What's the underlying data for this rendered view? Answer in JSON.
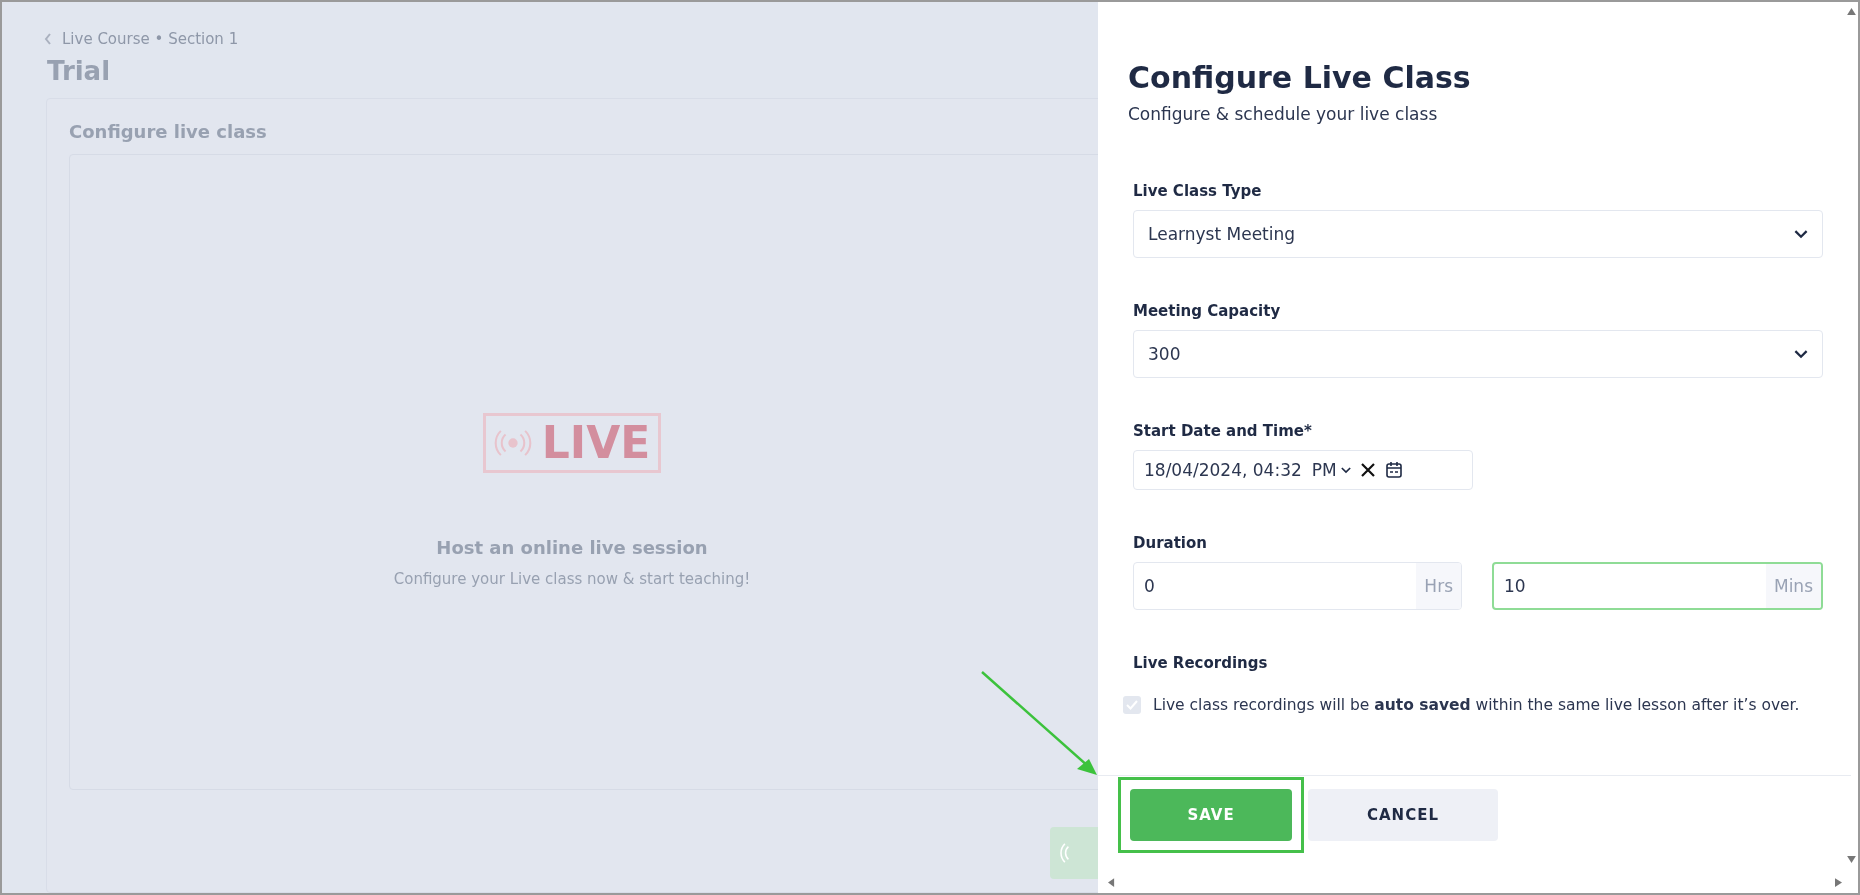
{
  "breadcrumb": {
    "text": "Live Course • Section 1"
  },
  "page_title": "Trial",
  "card": {
    "title": "Configure live class",
    "badge": "LIVE",
    "heading": "Host an online live session",
    "subtext": "Configure your Live class now & start teaching!"
  },
  "drawer": {
    "title": "Configure Live Class",
    "subtitle": "Configure & schedule your live class",
    "fields": [
      {
        "kind": "select",
        "label": "Live Class Type",
        "value": "Learnyst Meeting"
      },
      {
        "kind": "select",
        "label": "Meeting Capacity",
        "value": "300"
      },
      {
        "kind": "datetime",
        "label": "Start Date and Time*",
        "value": "18/04/2024, 04:32",
        "period": "PM"
      },
      {
        "kind": "duration",
        "label": "Duration",
        "parts": [
          {
            "value": "0",
            "unit": "Hrs",
            "focused": false
          },
          {
            "value": "10",
            "unit": "Mins",
            "focused": true
          }
        ]
      },
      {
        "kind": "checkbox",
        "label": "Live Recordings",
        "text": "Live class recordings will be **auto saved** within the same live lesson after it’s over.",
        "checked": true,
        "disabled": true
      }
    ],
    "buttons": [
      {
        "kind": "primary",
        "label": "SAVE",
        "highlighted": true
      },
      {
        "kind": "secondary",
        "label": "CANCEL",
        "highlighted": false
      }
    ]
  }
}
